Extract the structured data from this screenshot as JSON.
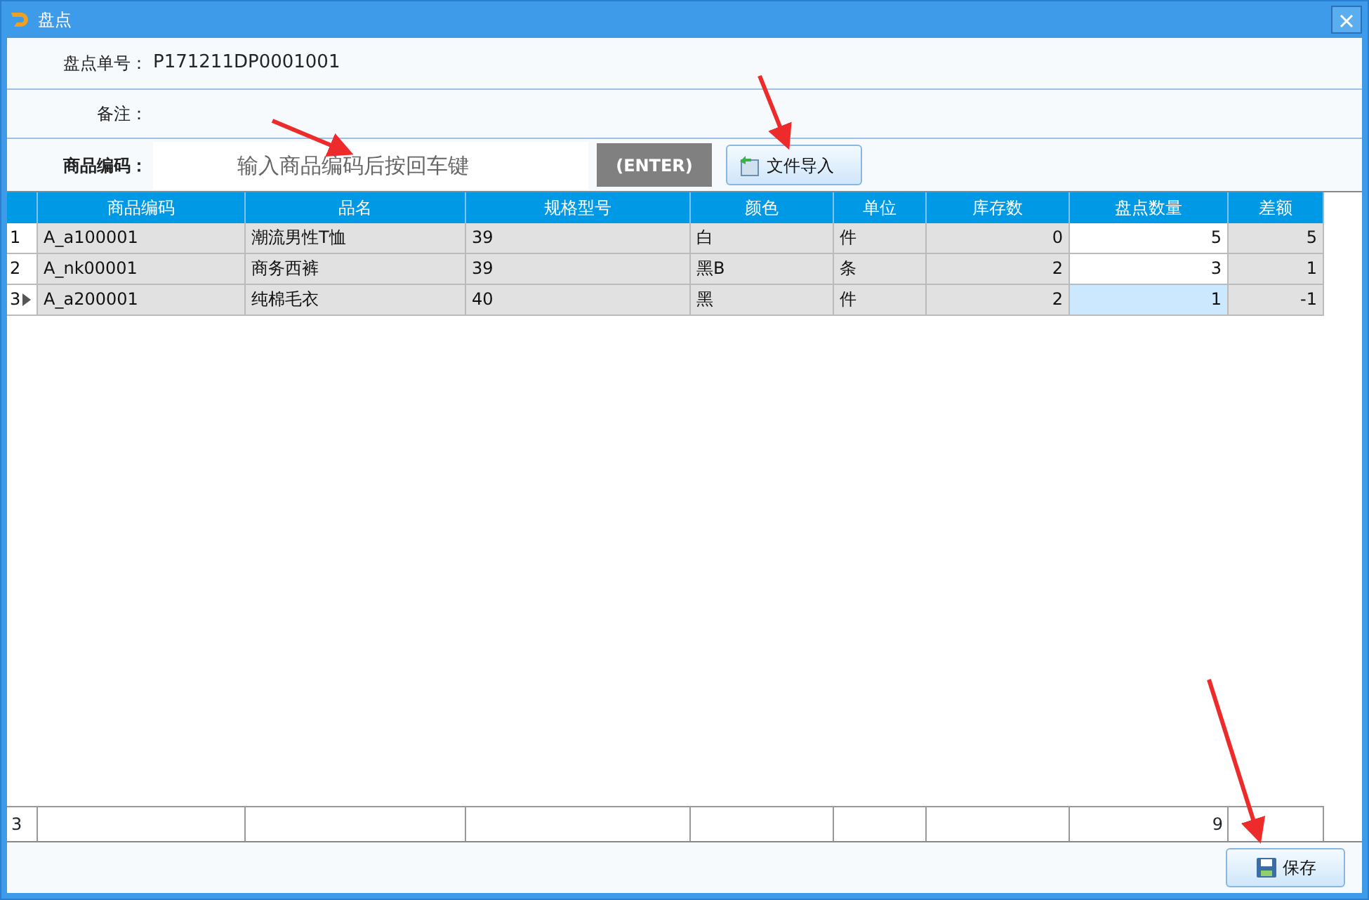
{
  "window": {
    "title": "盘点"
  },
  "form": {
    "order_label": "盘点单号：",
    "order_value": "P171211DP0001001",
    "remark_label": "备注：",
    "code_label": "商品编码：",
    "code_placeholder": "输入商品编码后按回车键",
    "enter_button": "(ENTER)",
    "import_button": "文件导入"
  },
  "table": {
    "columns": [
      "商品编码",
      "品名",
      "规格型号",
      "颜色",
      "单位",
      "库存数",
      "盘点数量",
      "差额"
    ],
    "rows": [
      {
        "index": "1",
        "selected": false,
        "cells": [
          "A_a100001",
          "潮流男性T恤",
          "39",
          "白",
          "件",
          "0",
          "5",
          "5"
        ]
      },
      {
        "index": "2",
        "selected": false,
        "cells": [
          "A_nk00001",
          "商务西裤",
          "39",
          "黑B",
          "条",
          "2",
          "3",
          "1"
        ]
      },
      {
        "index": "3",
        "selected": true,
        "cells": [
          "A_a200001",
          "纯棉毛衣",
          "40",
          "黑",
          "件",
          "2",
          "1",
          "-1"
        ]
      }
    ],
    "footer": {
      "count": "3",
      "total": "9"
    }
  },
  "buttons": {
    "save": "保存"
  }
}
